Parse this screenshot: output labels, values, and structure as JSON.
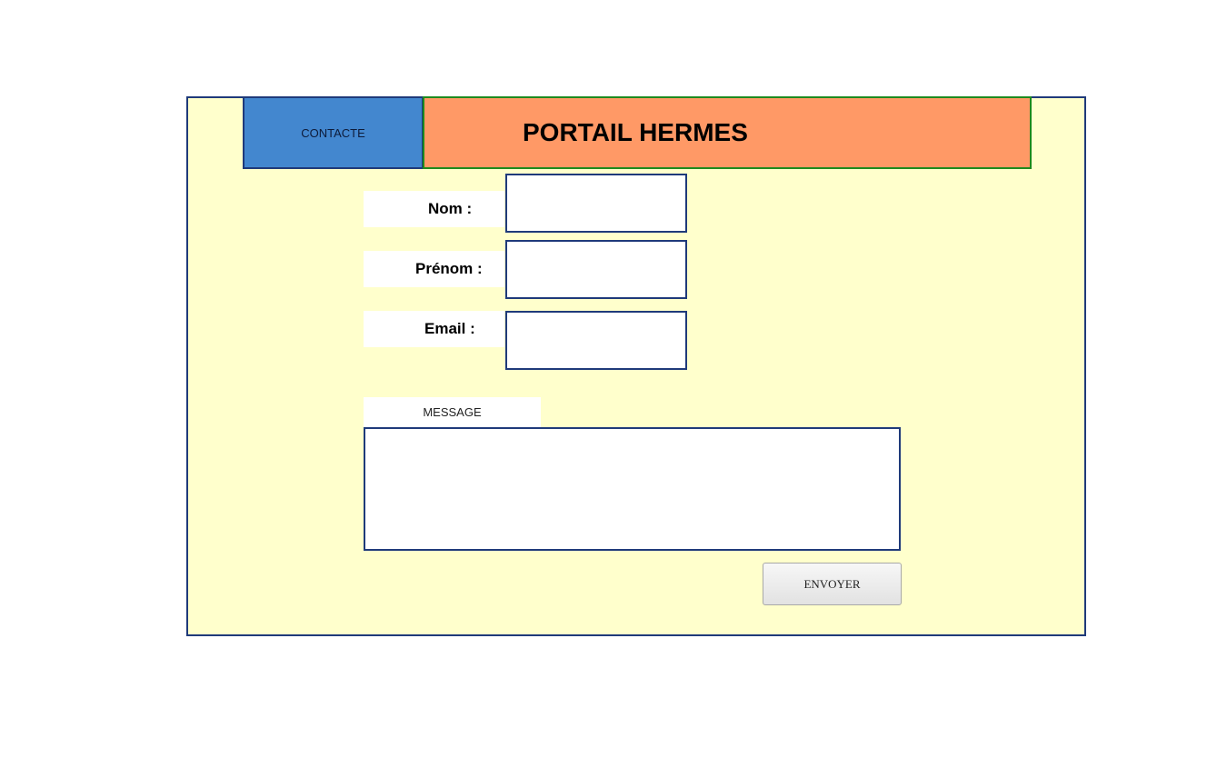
{
  "header": {
    "contact_label": "CONTACTE",
    "title": "PORTAIL HERMES"
  },
  "form": {
    "nom_label": "Nom :",
    "nom_value": "",
    "prenom_label": "Prénom :",
    "prenom_value": "",
    "email_label": "Email :",
    "email_value": "",
    "message_label": "MESSAGE",
    "message_value": "",
    "send_label": "ENVOYER"
  },
  "colors": {
    "page_background": "#ffffcc",
    "contact_background": "#4387cf",
    "title_background": "#ff9966",
    "border": "#1f3a7a",
    "title_border": "#1e8a1e"
  }
}
